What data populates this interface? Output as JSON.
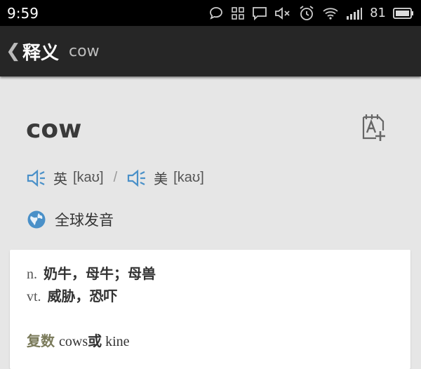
{
  "status_bar": {
    "time": "9:59",
    "battery_level": "81",
    "icons": [
      "chat-bubble-icon",
      "grid-icon",
      "message-icon",
      "mute-icon",
      "alarm-icon",
      "wifi-icon",
      "signal-icon",
      "battery-icon"
    ]
  },
  "app_bar": {
    "back_glyph": "❮",
    "title": "释义",
    "query": "cow"
  },
  "entry": {
    "headword": "cow",
    "pronunciations": [
      {
        "label": "英",
        "ipa": "[kaʊ]"
      },
      {
        "label": "美",
        "ipa": "[kaʊ]"
      }
    ],
    "pron_separator": "/",
    "global_pronunciation": "全球发音",
    "definitions": [
      {
        "pos": "n.",
        "meaning": "奶牛，母牛；母兽"
      },
      {
        "pos": "vt.",
        "meaning": "威胁，恐吓"
      }
    ],
    "plural": {
      "label": "复数",
      "form1": "cows",
      "or": "或",
      "form2": "kine"
    }
  },
  "colors": {
    "accent_blue": "#4a90c8",
    "app_bar": "#262626",
    "background": "#e6e6e6"
  }
}
